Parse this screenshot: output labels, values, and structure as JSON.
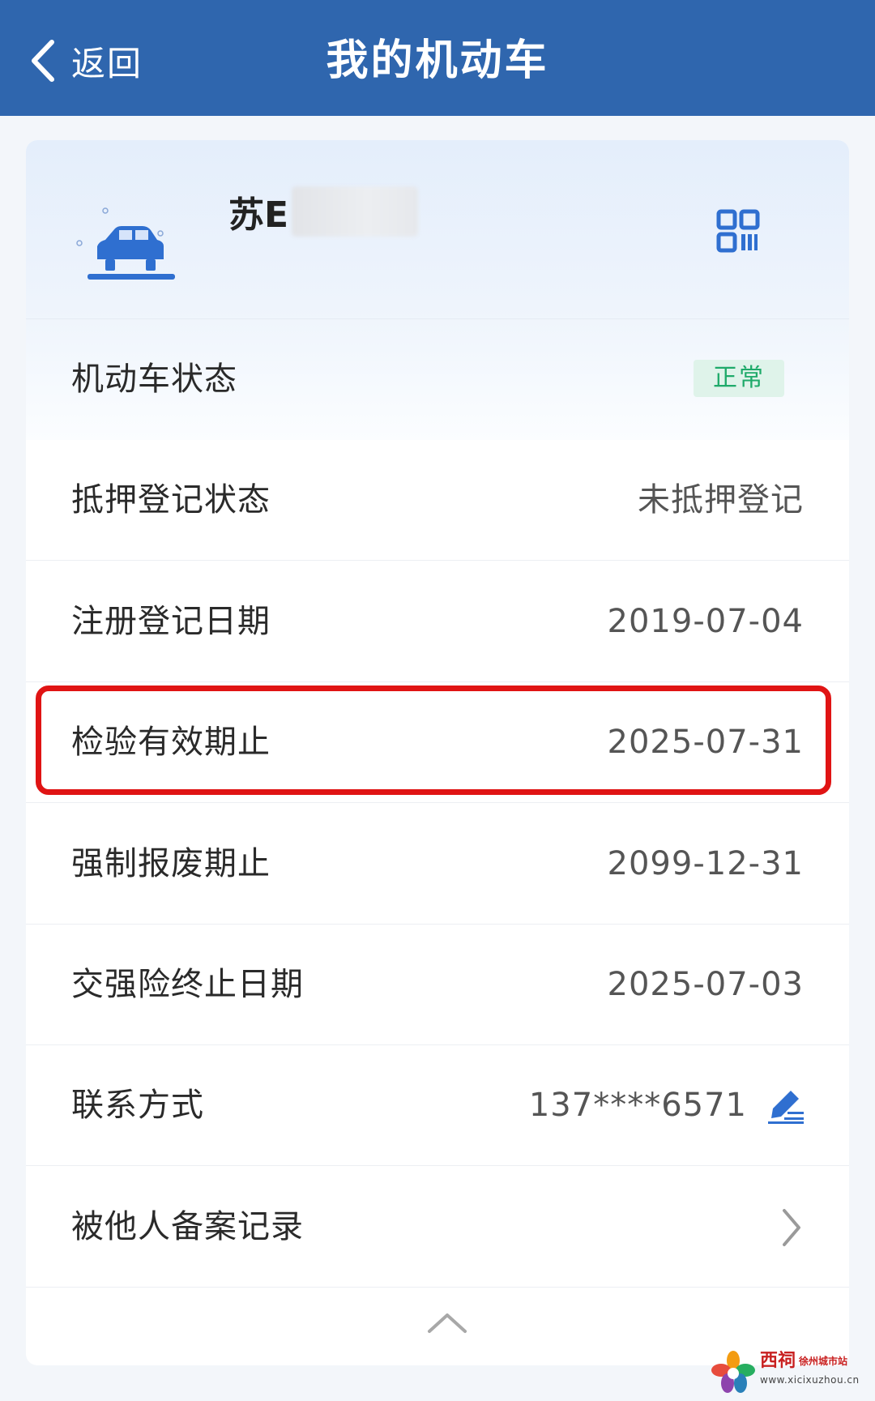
{
  "header": {
    "back_label": "返回",
    "title": "我的机动车"
  },
  "vehicle": {
    "plate_visible": "苏E",
    "plate_hidden": true
  },
  "rows": [
    {
      "label": "机动车状态",
      "badge": "正常"
    },
    {
      "label": "抵押登记状态",
      "value": "未抵押登记"
    },
    {
      "label": "注册登记日期",
      "value": "2019-07-04"
    },
    {
      "label": "检验有效期止",
      "value": "2025-07-31",
      "highlighted": true
    },
    {
      "label": "强制报废期止",
      "value": "2099-12-31"
    },
    {
      "label": "交强险终止日期",
      "value": "2025-07-03"
    },
    {
      "label": "联系方式",
      "value": "137****6571"
    },
    {
      "label": "被他人备案记录"
    }
  ],
  "colors": {
    "header_bg": "#2f66ae",
    "accent_blue": "#2f6fd0",
    "status_green": "#1faa6a",
    "highlight_red": "#e01414"
  },
  "icons": [
    "back-arrow-icon",
    "car-icon",
    "qr-code-icon",
    "edit-icon",
    "chevron-right-icon",
    "chevron-up-icon"
  ],
  "watermark": {
    "brand": "西祠",
    "site": "徐州城市站",
    "url": "www.xicixuzhou.cn"
  }
}
